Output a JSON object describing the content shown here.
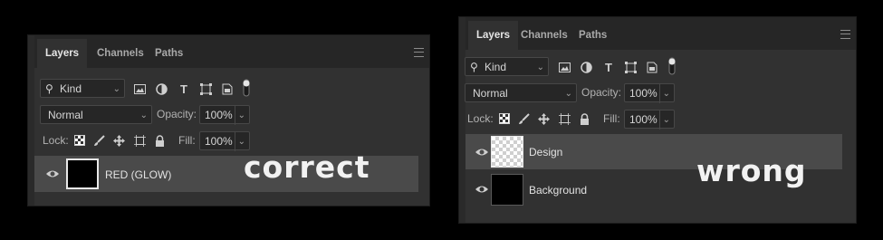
{
  "left_panel": {
    "tabs": [
      "Layers",
      "Channels",
      "Paths"
    ],
    "filter": {
      "value": "Kind"
    },
    "blend_mode": "Normal",
    "opacity": {
      "label": "Opacity:",
      "value": "100%"
    },
    "lock_label": "Lock:",
    "fill": {
      "label": "Fill:",
      "value": "100%"
    },
    "layers": [
      {
        "name": "RED (GLOW)",
        "selected": true
      }
    ],
    "caption": "correct"
  },
  "right_panel": {
    "tabs": [
      "Layers",
      "Channels",
      "Paths"
    ],
    "filter": {
      "value": "Kind"
    },
    "blend_mode": "Normal",
    "opacity": {
      "label": "Opacity:",
      "value": "100%"
    },
    "lock_label": "Lock:",
    "fill": {
      "label": "Fill:",
      "value": "100%"
    },
    "layers": [
      {
        "name": "Design",
        "selected": true
      },
      {
        "name": "Background",
        "selected": false
      }
    ],
    "caption": "wrong"
  },
  "icons": {
    "filter": [
      "image-filter-icon",
      "adjustment-filter-icon",
      "type-filter-icon",
      "shape-filter-icon",
      "smart-object-filter-icon",
      "filter-toggle-icon"
    ],
    "lock": [
      "lock-transparent-icon",
      "lock-image-icon",
      "lock-position-icon",
      "lock-artboard-icon",
      "lock-all-icon"
    ]
  },
  "colors": {
    "background": "#000000",
    "panel": "#313131",
    "selected_row": "#4a4a4a"
  }
}
